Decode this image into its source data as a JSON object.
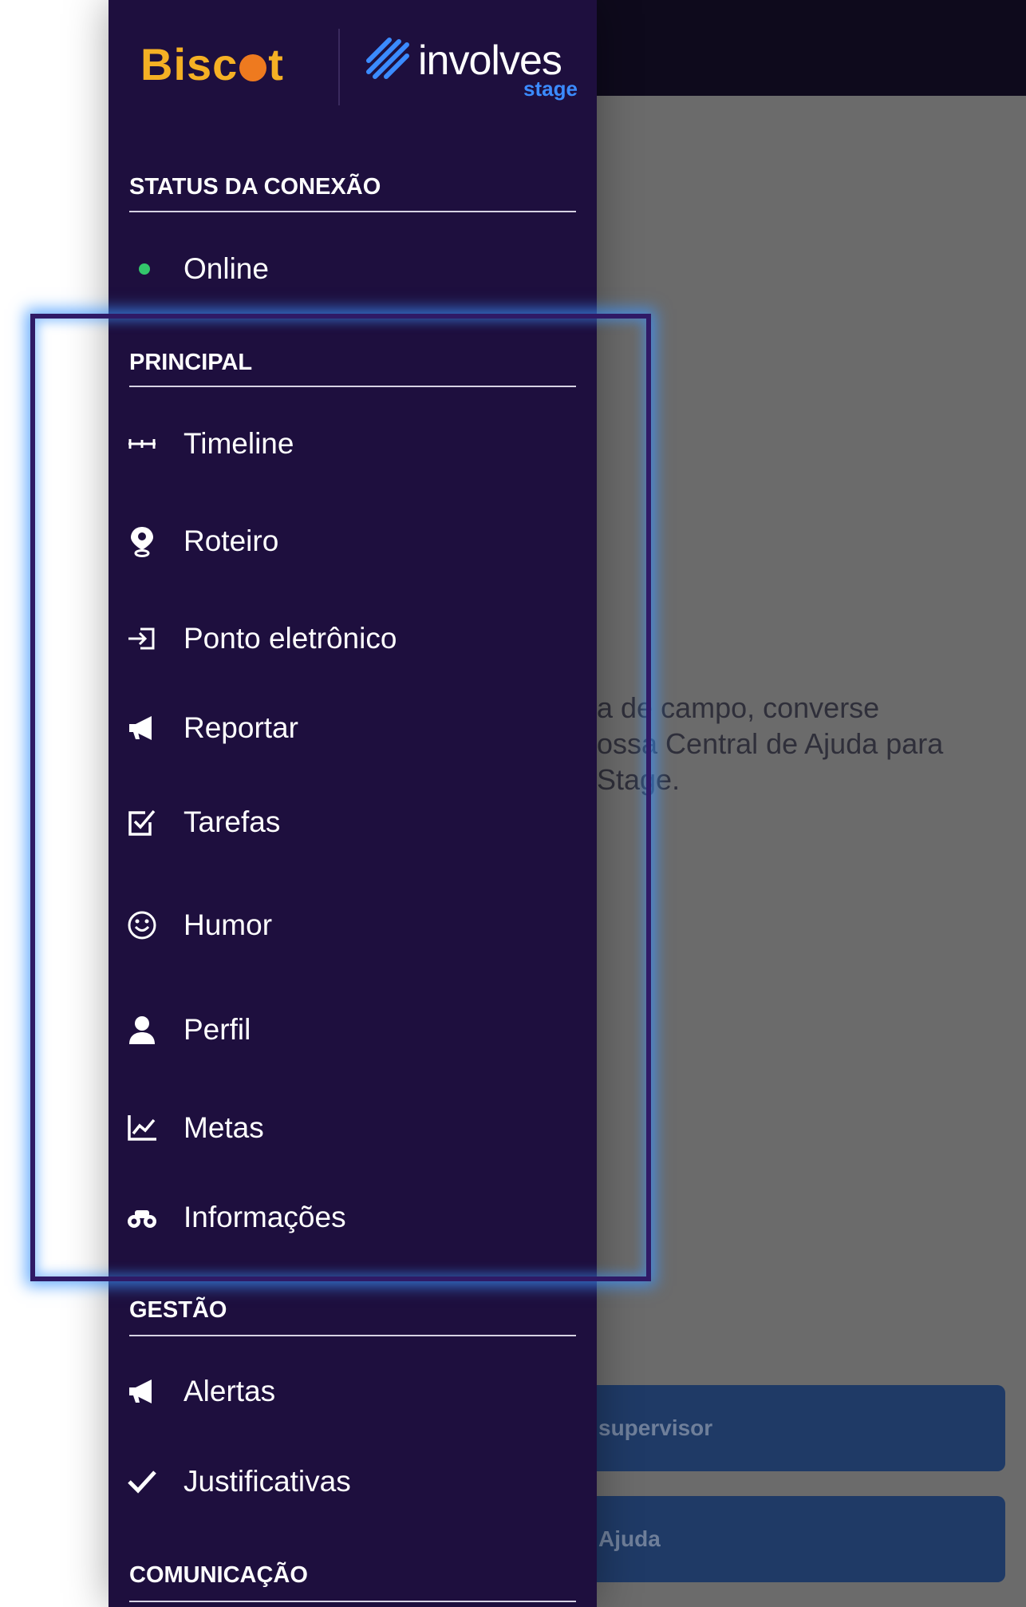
{
  "background": {
    "text_lines": [
      "a de campo, converse",
      "ossa Central de Ajuda para",
      "Stage."
    ],
    "buttons": [
      "supervisor",
      "Ajuda"
    ]
  },
  "logos": {
    "brand": "Biscoit",
    "brand_display": [
      "Bisc",
      "t"
    ],
    "partner": "involves",
    "partner_sub": "stage"
  },
  "sections": {
    "status": {
      "title": "STATUS DA CONEXÃO",
      "items": [
        {
          "label": "Online",
          "icon": "status-dot"
        }
      ]
    },
    "principal": {
      "title": "PRINCIPAL",
      "items": [
        {
          "label": "Timeline",
          "icon": "timeline-icon"
        },
        {
          "label": "Roteiro",
          "icon": "map-pin-icon"
        },
        {
          "label": "Ponto eletrônico",
          "icon": "sign-in-icon"
        },
        {
          "label": "Reportar",
          "icon": "megaphone-icon"
        },
        {
          "label": "Tarefas",
          "icon": "checklist-icon"
        },
        {
          "label": "Humor",
          "icon": "smiley-icon"
        },
        {
          "label": "Perfil",
          "icon": "user-icon"
        },
        {
          "label": "Metas",
          "icon": "line-chart-icon"
        },
        {
          "label": "Informações",
          "icon": "binoculars-icon"
        }
      ]
    },
    "gestao": {
      "title": "GESTÃO",
      "items": [
        {
          "label": "Alertas",
          "icon": "megaphone-icon"
        },
        {
          "label": "Justificativas",
          "icon": "checkmark-icon"
        }
      ]
    },
    "comunicacao": {
      "title": "COMUNICAÇÃO"
    }
  },
  "colors": {
    "drawer_bg": "#1e0f3e",
    "online_dot": "#33c66b",
    "brand_yellow": "#f5b024",
    "stage_blue": "#3b8bff",
    "highlight_glow": "#3c96ff"
  }
}
